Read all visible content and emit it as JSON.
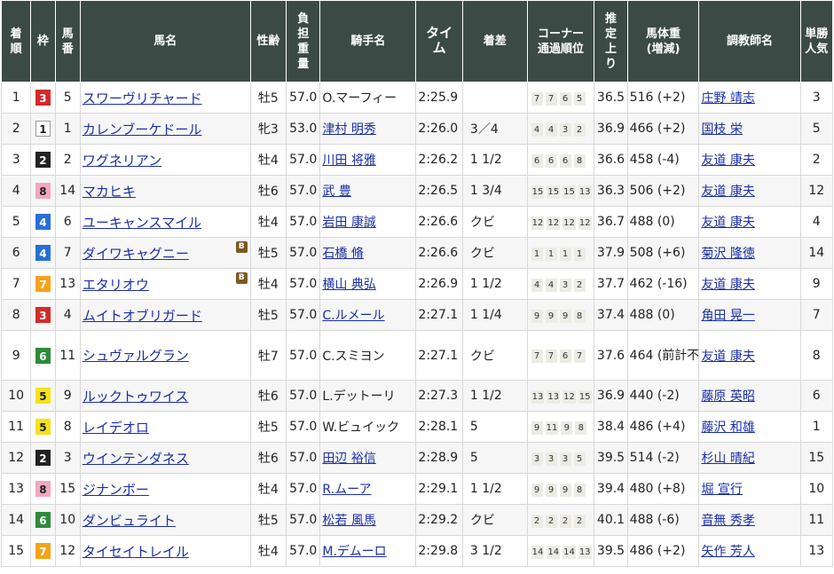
{
  "headers": {
    "rank": "着順",
    "frame": "枠",
    "number": "馬番",
    "horse": "馬名",
    "sex_age": "性齢",
    "burden": "負担重量",
    "jockey": "騎手名",
    "time": "タイム",
    "margin": "着差",
    "corner": "コーナー通過順位",
    "last3f": "推定上り",
    "weight": "馬体重(増減)",
    "trainer": "調教師名",
    "popularity": "単勝人気"
  },
  "frame_colors": {
    "1": "#ffffff",
    "2": "#222222",
    "3": "#d42a2a",
    "4": "#2a6fd4",
    "5": "#f5e21a",
    "6": "#2e8b3a",
    "7": "#f5a21a",
    "8": "#f4a7c0"
  },
  "rows": [
    {
      "rank": "1",
      "frame": "3",
      "number": "5",
      "horse": "スワーヴリチャード",
      "blinker": "",
      "sex_age": "牡5",
      "burden": "57.0",
      "jockey": "O.マーフィー",
      "jockey_link": false,
      "time": "2:25.9",
      "margin": "",
      "corners": [
        "7",
        "7",
        "6",
        "5"
      ],
      "last3f": "36.5",
      "weight": "516 (+2)",
      "trainer": "庄野 靖志",
      "popularity": "3"
    },
    {
      "rank": "2",
      "frame": "1",
      "number": "1",
      "horse": "カレンブーケドール",
      "blinker": "",
      "sex_age": "牝3",
      "burden": "53.0",
      "jockey": "津村 明秀",
      "jockey_link": true,
      "time": "2:26.0",
      "margin": "3／4",
      "corners": [
        "4",
        "4",
        "3",
        "2"
      ],
      "last3f": "36.9",
      "weight": "466 (+2)",
      "trainer": "国枝 栄",
      "popularity": "5"
    },
    {
      "rank": "3",
      "frame": "2",
      "number": "2",
      "horse": "ワグネリアン",
      "blinker": "",
      "sex_age": "牡4",
      "burden": "57.0",
      "jockey": "川田 将雅",
      "jockey_link": true,
      "time": "2:26.2",
      "margin": "1 1/2",
      "corners": [
        "6",
        "6",
        "6",
        "8"
      ],
      "last3f": "36.6",
      "weight": "458 (-4)",
      "trainer": "友道 康夫",
      "popularity": "2"
    },
    {
      "rank": "4",
      "frame": "8",
      "number": "14",
      "horse": "マカヒキ",
      "blinker": "",
      "sex_age": "牡6",
      "burden": "57.0",
      "jockey": "武 豊",
      "jockey_link": true,
      "time": "2:26.5",
      "margin": "1 3/4",
      "corners": [
        "15",
        "15",
        "15",
        "13"
      ],
      "last3f": "36.3",
      "weight": "506 (+2)",
      "trainer": "友道 康夫",
      "popularity": "12"
    },
    {
      "rank": "5",
      "frame": "4",
      "number": "6",
      "horse": "ユーキャンスマイル",
      "blinker": "",
      "sex_age": "牡4",
      "burden": "57.0",
      "jockey": "岩田 康誠",
      "jockey_link": true,
      "time": "2:26.6",
      "margin": "クビ",
      "corners": [
        "12",
        "12",
        "12",
        "12"
      ],
      "last3f": "36.7",
      "weight": "488 (0)",
      "trainer": "友道 康夫",
      "popularity": "4"
    },
    {
      "rank": "6",
      "frame": "4",
      "number": "7",
      "horse": "ダイワキャグニー",
      "blinker": "B",
      "sex_age": "牡5",
      "burden": "57.0",
      "jockey": "石橋 脩",
      "jockey_link": true,
      "time": "2:26.6",
      "margin": "クビ",
      "corners": [
        "1",
        "1",
        "1",
        "1"
      ],
      "last3f": "37.9",
      "weight": "508 (+6)",
      "trainer": "菊沢 隆徳",
      "popularity": "14"
    },
    {
      "rank": "7",
      "frame": "7",
      "number": "13",
      "horse": "エタリオウ",
      "blinker": "B",
      "sex_age": "牡4",
      "burden": "57.0",
      "jockey": "横山 典弘",
      "jockey_link": true,
      "time": "2:26.9",
      "margin": "1 1/2",
      "corners": [
        "4",
        "4",
        "3",
        "2"
      ],
      "last3f": "37.7",
      "weight": "462 (-16)",
      "trainer": "友道 康夫",
      "popularity": "9"
    },
    {
      "rank": "8",
      "frame": "3",
      "number": "4",
      "horse": "ムイトオブリガード",
      "blinker": "",
      "sex_age": "牡5",
      "burden": "57.0",
      "jockey": "C.ルメール",
      "jockey_link": true,
      "time": "2:27.1",
      "margin": "1 1/4",
      "corners": [
        "9",
        "9",
        "9",
        "8"
      ],
      "last3f": "37.4",
      "weight": "488 (0)",
      "trainer": "角田 晃一",
      "popularity": "7"
    },
    {
      "rank": "9",
      "frame": "6",
      "number": "11",
      "horse": "シュヴァルグラン",
      "blinker": "",
      "sex_age": "牡7",
      "burden": "57.0",
      "jockey": "C.スミヨン",
      "jockey_link": false,
      "time": "2:27.1",
      "margin": "クビ",
      "corners": [
        "7",
        "7",
        "6",
        "7"
      ],
      "last3f": "37.6",
      "weight": "464 (前計不)",
      "trainer": "友道 康夫",
      "popularity": "8"
    },
    {
      "rank": "10",
      "frame": "5",
      "number": "9",
      "horse": "ルックトゥワイス",
      "blinker": "",
      "sex_age": "牡6",
      "burden": "57.0",
      "jockey": "L.デットーリ",
      "jockey_link": false,
      "time": "2:27.3",
      "margin": "1 1/2",
      "corners": [
        "13",
        "13",
        "12",
        "15"
      ],
      "last3f": "36.9",
      "weight": "440 (-2)",
      "trainer": "藤原 英昭",
      "popularity": "6"
    },
    {
      "rank": "11",
      "frame": "5",
      "number": "8",
      "horse": "レイデオロ",
      "blinker": "",
      "sex_age": "牡5",
      "burden": "57.0",
      "jockey": "W.ビュイック",
      "jockey_link": false,
      "time": "2:28.1",
      "margin": "5",
      "corners": [
        "9",
        "11",
        "9",
        "8"
      ],
      "last3f": "38.4",
      "weight": "486 (+4)",
      "trainer": "藤沢 和雄",
      "popularity": "1"
    },
    {
      "rank": "12",
      "frame": "2",
      "number": "3",
      "horse": "ウインテンダネス",
      "blinker": "",
      "sex_age": "牡6",
      "burden": "57.0",
      "jockey": "田辺 裕信",
      "jockey_link": true,
      "time": "2:28.9",
      "margin": "5",
      "corners": [
        "3",
        "3",
        "3",
        "5"
      ],
      "last3f": "39.5",
      "weight": "514 (-2)",
      "trainer": "杉山 晴紀",
      "popularity": "15"
    },
    {
      "rank": "13",
      "frame": "8",
      "number": "15",
      "horse": "ジナンボー",
      "blinker": "",
      "sex_age": "牡4",
      "burden": "57.0",
      "jockey": "R.ムーア",
      "jockey_link": true,
      "time": "2:29.1",
      "margin": "1 1/2",
      "corners": [
        "9",
        "9",
        "9",
        "8"
      ],
      "last3f": "39.4",
      "weight": "480 (+8)",
      "trainer": "堀 宣行",
      "popularity": "10"
    },
    {
      "rank": "14",
      "frame": "6",
      "number": "10",
      "horse": "ダンビュライト",
      "blinker": "",
      "sex_age": "牡5",
      "burden": "57.0",
      "jockey": "松若 風馬",
      "jockey_link": true,
      "time": "2:29.2",
      "margin": "クビ",
      "corners": [
        "2",
        "2",
        "2",
        "2"
      ],
      "last3f": "40.1",
      "weight": "488 (-6)",
      "trainer": "音無 秀孝",
      "popularity": "11"
    },
    {
      "rank": "15",
      "frame": "7",
      "number": "12",
      "horse": "タイセイトレイル",
      "blinker": "",
      "sex_age": "牡4",
      "burden": "57.0",
      "jockey": "M.デムーロ",
      "jockey_link": true,
      "time": "2:29.8",
      "margin": "3 1/2",
      "corners": [
        "14",
        "14",
        "14",
        "13"
      ],
      "last3f": "39.5",
      "weight": "486 (+2)",
      "trainer": "矢作 芳人",
      "popularity": "13"
    }
  ]
}
